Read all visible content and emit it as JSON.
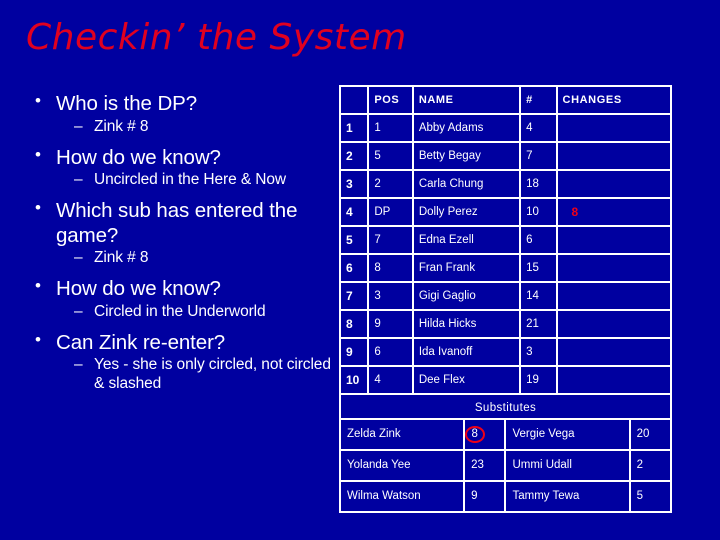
{
  "slide": {
    "title": "Checkin’ the System",
    "background_color": "#0000A0",
    "title_color": "#E00020",
    "accent_red": "#EE0018"
  },
  "bullets": [
    {
      "level": 1,
      "text": "Who is the DP?"
    },
    {
      "level": 2,
      "text": "Zink # 8"
    },
    {
      "level": 1,
      "text": "How do we know?"
    },
    {
      "level": 2,
      "text": "Uncircled in the Here & Now"
    },
    {
      "level": 1,
      "text": "Which sub has entered the game?"
    },
    {
      "level": 2,
      "text": "Zink # 8"
    },
    {
      "level": 1,
      "text": "How do we know?"
    },
    {
      "level": 2,
      "text": "Circled in the Underworld"
    },
    {
      "level": 1,
      "text": "Can Zink re-enter?"
    },
    {
      "level": 2,
      "text": "Yes - she is only circled, not circled & slashed"
    }
  ],
  "roster": {
    "headers": [
      "",
      "POS",
      "NAME",
      "#",
      "CHANGES"
    ],
    "rows": [
      {
        "idx": "1",
        "pos": "1",
        "name": "Abby Adams",
        "num": "4",
        "changes": ""
      },
      {
        "idx": "2",
        "pos": "5",
        "name": "Betty Begay",
        "num": "7",
        "changes": ""
      },
      {
        "idx": "3",
        "pos": "2",
        "name": "Carla Chung",
        "num": "18",
        "changes": ""
      },
      {
        "idx": "4",
        "pos": "DP",
        "name": "Dolly Perez",
        "num": "10",
        "changes": "8"
      },
      {
        "idx": "5",
        "pos": "7",
        "name": "Edna Ezell",
        "num": "6",
        "changes": ""
      },
      {
        "idx": "6",
        "pos": "8",
        "name": "Fran Frank",
        "num": "15",
        "changes": ""
      },
      {
        "idx": "7",
        "pos": "3",
        "name": "Gigi Gaglio",
        "num": "14",
        "changes": ""
      },
      {
        "idx": "8",
        "pos": "9",
        "name": "Hilda Hicks",
        "num": "21",
        "changes": ""
      },
      {
        "idx": "9",
        "pos": "6",
        "name": "Ida Ivanoff",
        "num": "3",
        "changes": ""
      },
      {
        "idx": "10",
        "pos": "4",
        "name": "Dee Flex",
        "num": "19",
        "changes": ""
      }
    ],
    "substitutes_label": "Substitutes"
  },
  "substitutes": {
    "rows": [
      {
        "name_a": "Zelda Zink",
        "num_a": "8",
        "circled_a": true,
        "name_b": "Vergie Vega",
        "num_b": "20"
      },
      {
        "name_a": "Yolanda Yee",
        "num_a": "23",
        "circled_a": false,
        "name_b": "Ummi Udall",
        "num_b": "2"
      },
      {
        "name_a": "Wilma Watson",
        "num_a": "9",
        "circled_a": false,
        "name_b": "Tammy Tewa",
        "num_b": "5"
      }
    ]
  }
}
